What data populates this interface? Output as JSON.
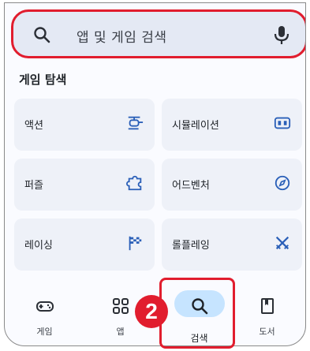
{
  "search": {
    "placeholder": "앱 및 게임 검색"
  },
  "section": {
    "title": "게임 탐색"
  },
  "categories": [
    {
      "label": "액션",
      "icon": "helicopter-icon"
    },
    {
      "label": "시뮬레이션",
      "icon": "simulation-icon"
    },
    {
      "label": "퍼즐",
      "icon": "puzzle-icon"
    },
    {
      "label": "어드벤처",
      "icon": "compass-icon"
    },
    {
      "label": "레이싱",
      "icon": "checkered-flag-icon"
    },
    {
      "label": "롤플레잉",
      "icon": "crossed-swords-icon"
    }
  ],
  "nav": {
    "items": [
      {
        "label": "게임",
        "icon": "gamepad-icon"
      },
      {
        "label": "앱",
        "icon": "apps-grid-icon"
      },
      {
        "label": "검색",
        "icon": "search-icon",
        "active": true
      },
      {
        "label": "도서",
        "icon": "bookmark-book-icon"
      }
    ]
  },
  "annotation": {
    "step": "2"
  },
  "colors": {
    "accent": "#e11d2e",
    "icon_blue": "#2a5fb8",
    "active_pill": "#c6e4ff"
  }
}
